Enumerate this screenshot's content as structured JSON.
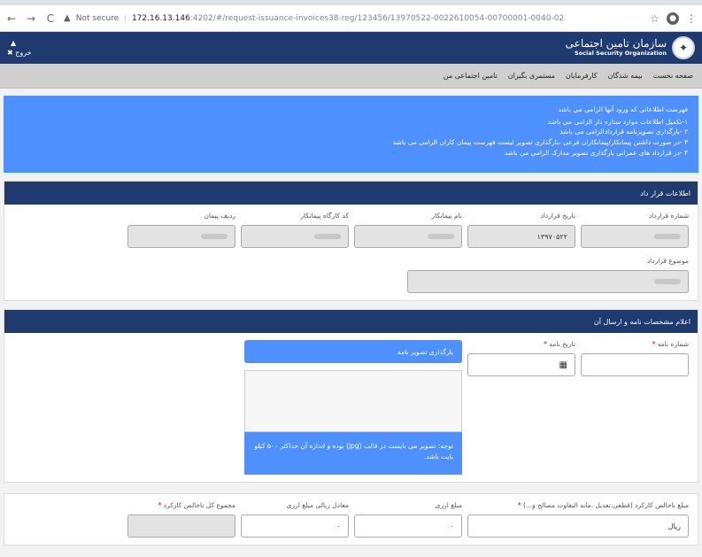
{
  "browser": {
    "security_label": "Not secure",
    "url_host": "172.16.13.146",
    "url_rest": ":4202/#/request-issuance-invoices38-reg/123456/13970522-0022610054-00700001-0040-02"
  },
  "header": {
    "user_icon": "user-icon",
    "logout_label": "خروج",
    "org_name_fa": "سازمان تامین اجتماعی",
    "org_name_en": "Social Security Organization"
  },
  "nav": {
    "items": [
      "صفحه نخست",
      "بیمه شدگان",
      "کارفرمایان",
      "مستمری بگیران",
      "تامین اجتماعی من"
    ]
  },
  "info": {
    "title": "فهرست اطلاعاتی که ورود آنها الزامی می باشد",
    "lines": [
      "۱-تکمیل اطلاعات موارد ستاره دار الزامی می باشد",
      "۲ -بارگذاری تصویرنامه قراردادالزامی می باشد",
      "۳ -در صورت داشتن پیمانکار/پیمانکاران فرعی ،بارگذاری تصویر لیست فهرست پیمان کاران الزامی می باشد",
      "۴ -در قرارداد های عمرانی بارگذاری تصویر مدارک الزامی می باشد"
    ]
  },
  "contract": {
    "title": "اطلاعات قرار داد",
    "labels": [
      "شماره قرارداد",
      "تاریخ قرارداد",
      "نام پیمانکار",
      "کد کارگاه پیمانکار",
      "ردیف پیمان"
    ],
    "date_value": "۱۳۹۷۰۵۲۲",
    "subject_label": "موضوع قرارداد"
  },
  "letter": {
    "title": "اعلام مشخصات نامه و ارسال آن",
    "number_label": "شماره نامه",
    "date_label": "تاریخ نامه",
    "upload_label": "بارگذاری تصویر نامه",
    "note": "توجه: تصویر می بایست در قالب (jpg) بوده و اندازه آن حداکثر ۵۰۰ کیلو بایت باشد.",
    "req_mark": "*"
  },
  "amounts": {
    "labels": [
      "مبلغ ناخالص کارکرد (قطعی،تعدیل ،مابه التفاوت مصالح و...)",
      "مبلغ ارزی",
      "معادل ریالی مبلغ ارزی",
      "مجموع کل ناخالص کارکرد"
    ],
    "rial_placeholder": "ریال",
    "zero": "۰"
  }
}
